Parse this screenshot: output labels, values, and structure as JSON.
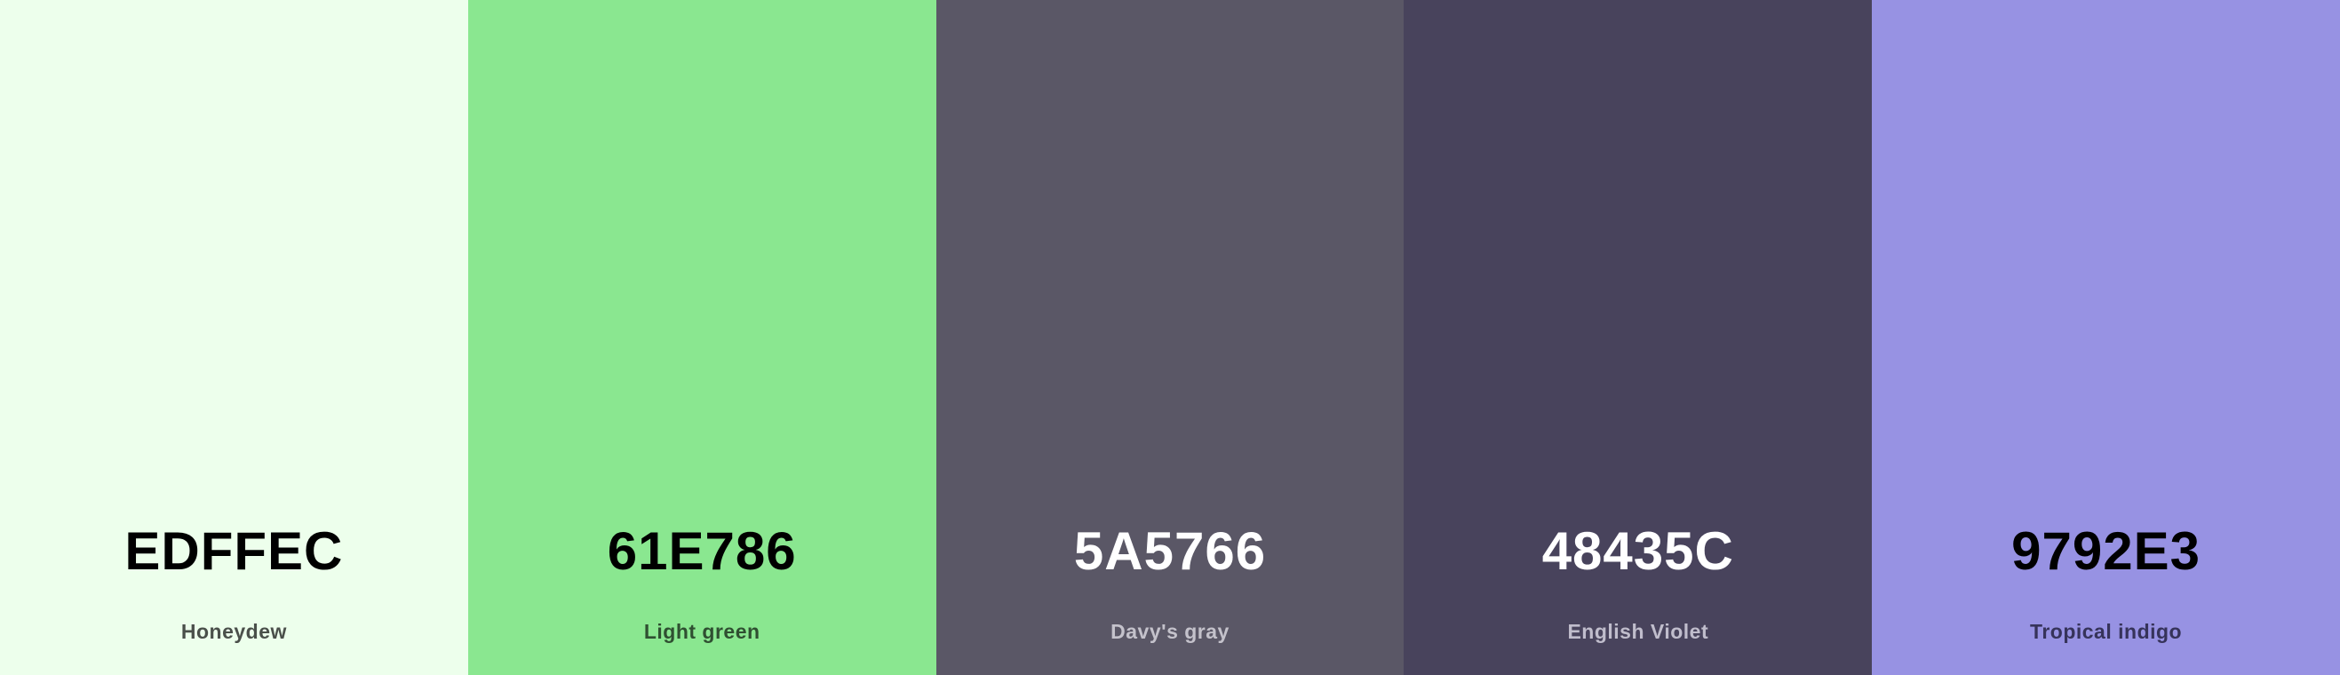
{
  "palette": {
    "swatches": [
      {
        "hex": "EDFFEC",
        "name": "Honeydew",
        "color": "#EDFFEC"
      },
      {
        "hex": "61E786",
        "name": "Light green",
        "color": "#8AE790"
      },
      {
        "hex": "5A5766",
        "name": "Davy's gray",
        "color": "#5A5766"
      },
      {
        "hex": "48435C",
        "name": "English Violet",
        "color": "#48435C"
      },
      {
        "hex": "9792E3",
        "name": "Tropical indigo",
        "color": "#9792E3"
      }
    ]
  }
}
